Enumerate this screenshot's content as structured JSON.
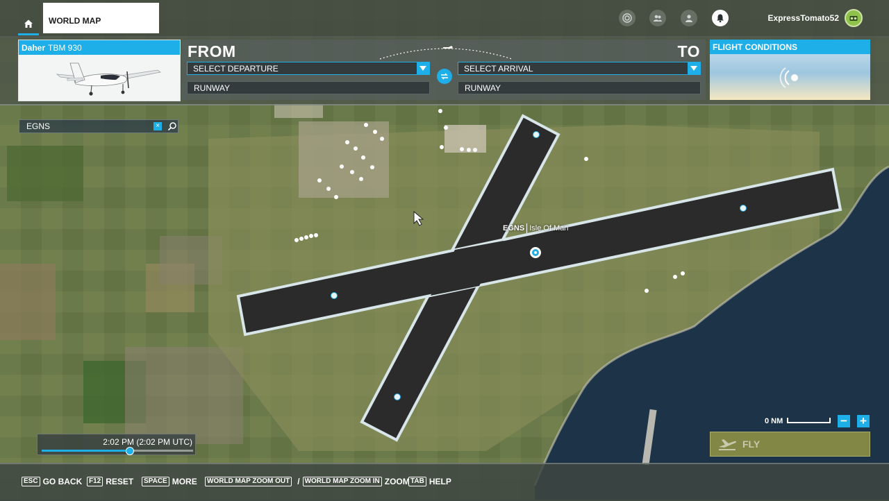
{
  "topbar": {
    "tab_label": "WORLD MAP",
    "username": "ExpressTomato52",
    "icons": [
      "home-icon",
      "activity-icon",
      "friends-icon",
      "profile-icon",
      "notifications-bell-icon",
      "avatar"
    ]
  },
  "aircraft": {
    "manufacturer": "Daher",
    "model": "TBM 930"
  },
  "route": {
    "from_label": "FROM",
    "to_label": "TO",
    "departure_placeholder": "SELECT DEPARTURE",
    "arrival_placeholder": "SELECT ARRIVAL",
    "departure_runway": "RUNWAY",
    "arrival_runway": "RUNWAY"
  },
  "conditions": {
    "title": "FLIGHT CONDITIONS"
  },
  "search": {
    "value": "EGNS",
    "clear": "×"
  },
  "map": {
    "airport_code": "EGNS",
    "airport_name": "Isle Of Man"
  },
  "time": {
    "display": "2:02 PM (2:02 PM UTC)",
    "progress": 0.58
  },
  "scale": {
    "label": "0 NM"
  },
  "zoom": {
    "out_label": "−",
    "in_label": "+"
  },
  "fly": {
    "label": "FLY"
  },
  "hints": [
    {
      "key": "ESC",
      "label": "GO BACK"
    },
    {
      "key": "F12",
      "label": "RESET"
    },
    {
      "key": "SPACE",
      "label": "MORE"
    },
    {
      "key": "WORLD MAP ZOOM OUT",
      "sep": "/"
    },
    {
      "key": "WORLD MAP ZOOM IN",
      "label": "ZOOM"
    },
    {
      "key": "TAB",
      "label": "HELP"
    }
  ],
  "colors": {
    "accent": "#1eaee8",
    "runway": "#2b2b2b",
    "sea": "#1d3348",
    "fly_button": "#949646"
  }
}
